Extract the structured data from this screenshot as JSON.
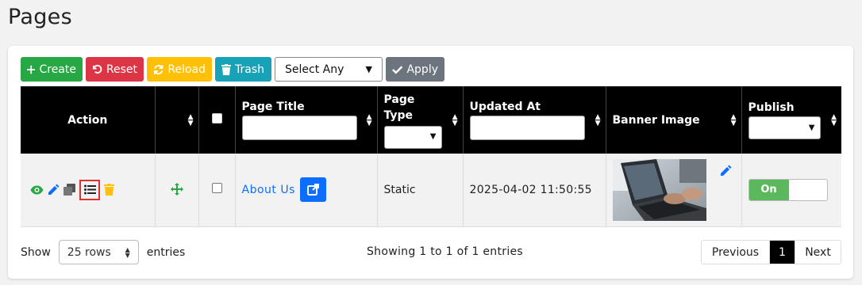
{
  "page": {
    "title": "Pages"
  },
  "toolbar": {
    "create_label": "Create",
    "reset_label": "Reset",
    "reload_label": "Reload",
    "trash_label": "Trash",
    "bulk_select_value": "Select Any",
    "apply_label": "Apply"
  },
  "table": {
    "headers": {
      "action": "Action",
      "page_title": "Page Title",
      "page_type_line1": "Page",
      "page_type_line2": "Type",
      "updated_at": "Updated At",
      "banner_image": "Banner Image",
      "publish": "Publish"
    },
    "rows": [
      {
        "page_title": "About Us",
        "page_type": "Static",
        "updated_at": "2025-04-02 11:50:55",
        "publish_label": "On",
        "publish_on": true
      }
    ]
  },
  "footer": {
    "show_label": "Show",
    "rows_value": "25 rows",
    "entries_label": "entries",
    "showing_text": "Showing 1 to 1 of 1 entries",
    "previous_label": "Previous",
    "current_page": "1",
    "next_label": "Next"
  },
  "colors": {
    "create": "#28a745",
    "reset": "#dc3545",
    "reload": "#ffc107",
    "trash": "#17a2b8",
    "apply": "#6c757d",
    "header_bg": "#000000",
    "link": "#0d6efd",
    "publish_on": "#5cb85c"
  },
  "icons": {
    "create": "plus-icon",
    "reset": "undo-icon",
    "reload": "sync-icon",
    "trash": "trash-icon",
    "apply": "check-icon",
    "row_actions": [
      "eye-icon",
      "pencil-icon",
      "copy-icon",
      "list-icon",
      "trash-icon"
    ],
    "drag": "move-icon",
    "external": "external-link-icon"
  }
}
